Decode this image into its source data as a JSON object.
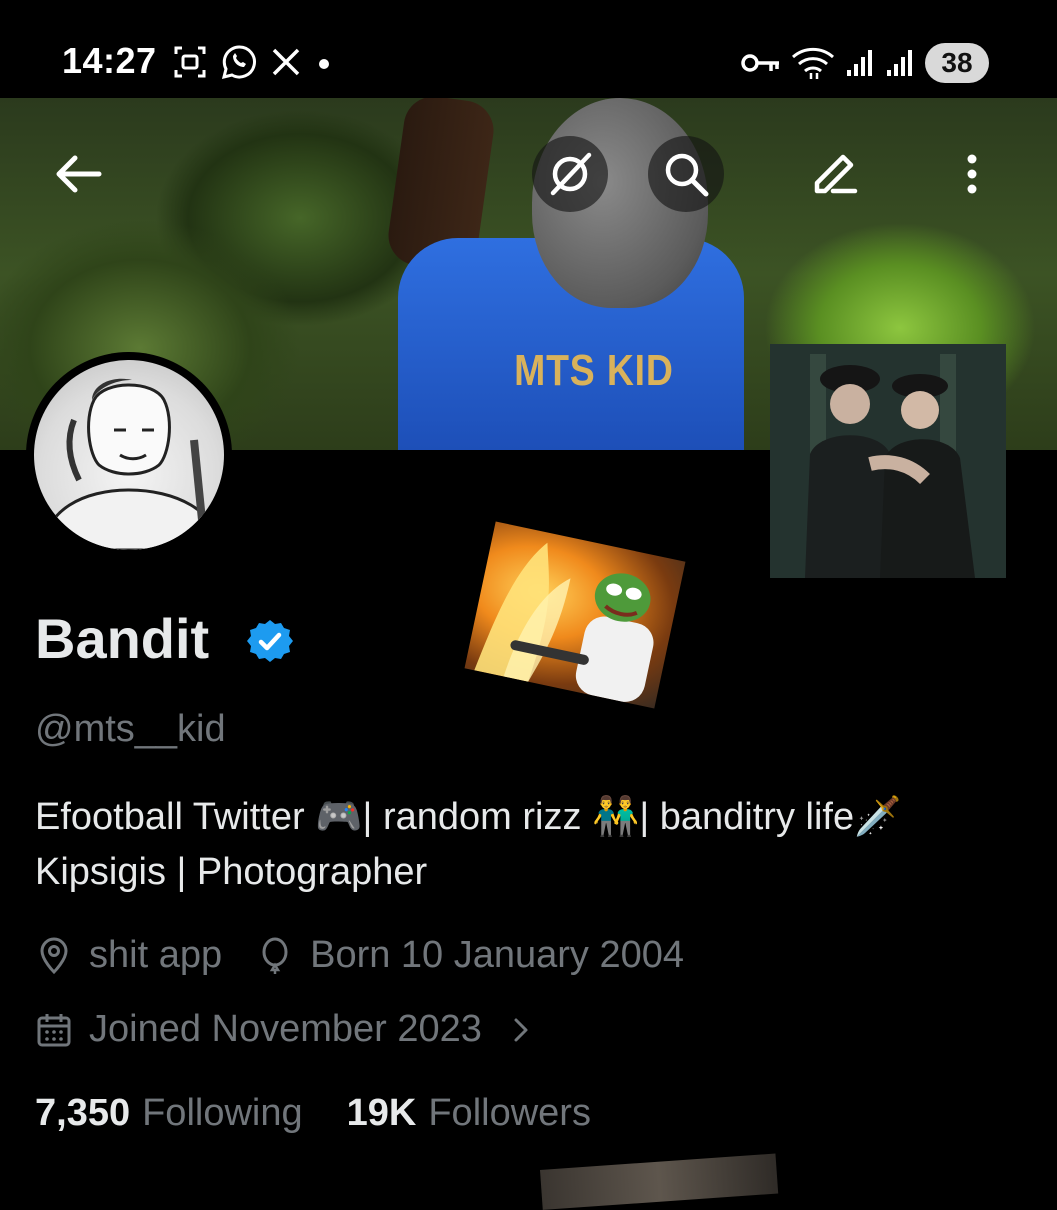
{
  "status_bar": {
    "time": "14:27",
    "left_icons": [
      "screenshot-icon",
      "whatsapp-icon",
      "x-logo-icon",
      "notification-dot-icon"
    ],
    "right_icons": [
      "vpn-key-icon",
      "wifi-icon",
      "signal-icon",
      "signal-icon"
    ],
    "battery": "38"
  },
  "header": {
    "buttons": [
      "back-arrow-icon",
      "grok-icon",
      "search-icon",
      "edit-icon",
      "more-vertical-icon"
    ]
  },
  "banner": {
    "jersey_text": "MTS KID"
  },
  "profile": {
    "name": "Bandit",
    "verified": true,
    "verified_color": "#1d9bf0",
    "handle": "@mts__kid",
    "bio_line1": "Efootball Twitter 🎮| random rizz 👬| banditry life🗡️",
    "bio_line2": "Kipsigis | Photographer",
    "location": "shit app",
    "birthday": "Born 10 January 2004",
    "joined": "Joined November 2023",
    "following_count": "7,350",
    "following_label": "Following",
    "followers_count": "19K",
    "followers_label": "Followers"
  },
  "colors": {
    "background": "#000000",
    "primary_text": "#e7e9ea",
    "secondary_text": "#71767b"
  }
}
